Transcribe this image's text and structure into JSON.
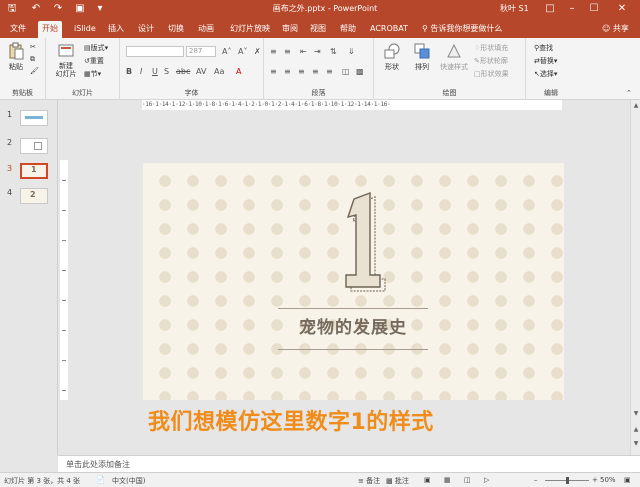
{
  "window": {
    "title": "画布之外.pptx - PowerPoint",
    "user": "秋叶 S1"
  },
  "tabs": [
    "文件",
    "开始",
    "iSlide",
    "插入",
    "设计",
    "切换",
    "动画",
    "幻灯片放映",
    "审阅",
    "视图",
    "帮助",
    "ACROBAT"
  ],
  "active_tab": "开始",
  "tell_me": "告诉我你想要做什么",
  "share": "共享",
  "ribbon": {
    "clipboard": {
      "label": "剪贴板",
      "paste": "粘贴"
    },
    "slides": {
      "label": "幻灯片",
      "new_slide": "新建\n幻灯片",
      "layout": "版式",
      "reset": "重置",
      "section": "节"
    },
    "font": {
      "label": "字体",
      "font_size": "287"
    },
    "paragraph": {
      "label": "段落"
    },
    "drawing": {
      "label": "绘图",
      "shapes": "形状",
      "arrange": "排列",
      "quick_styles": "快速样式",
      "fill": "形状填充",
      "outline": "形状轮廓",
      "effects": "形状效果"
    },
    "editing": {
      "label": "编辑",
      "find": "查找",
      "replace": "替换",
      "select": "选择"
    }
  },
  "ruler": {
    "h_text": "·16·1·14·1·12·1·10·1·8·1·6·1·4·1·2·1·0·1·2·1·4·1·6·1·8·1·10·1·12·1·14·1·16·"
  },
  "thumbnails": [
    {
      "num": "1",
      "caption": ""
    },
    {
      "num": "2",
      "caption": ""
    },
    {
      "num": "3",
      "caption": "1"
    },
    {
      "num": "4",
      "caption": "2"
    }
  ],
  "slide": {
    "big_number": "1",
    "title": "宠物的发展史"
  },
  "annotation": "我们想模仿这里数字1的样式",
  "notes_placeholder": "单击此处添加备注",
  "status": {
    "slide_info": "幻灯片 第 3 张，共 4 张",
    "language": "中文(中国)",
    "notes": "备注",
    "comments": "批注",
    "zoom": "50%"
  },
  "colors": {
    "accent": "#b7472a",
    "slide_bg": "#f7f3e8",
    "slide_text": "#776a5e",
    "annotation": "#f08c1a"
  }
}
